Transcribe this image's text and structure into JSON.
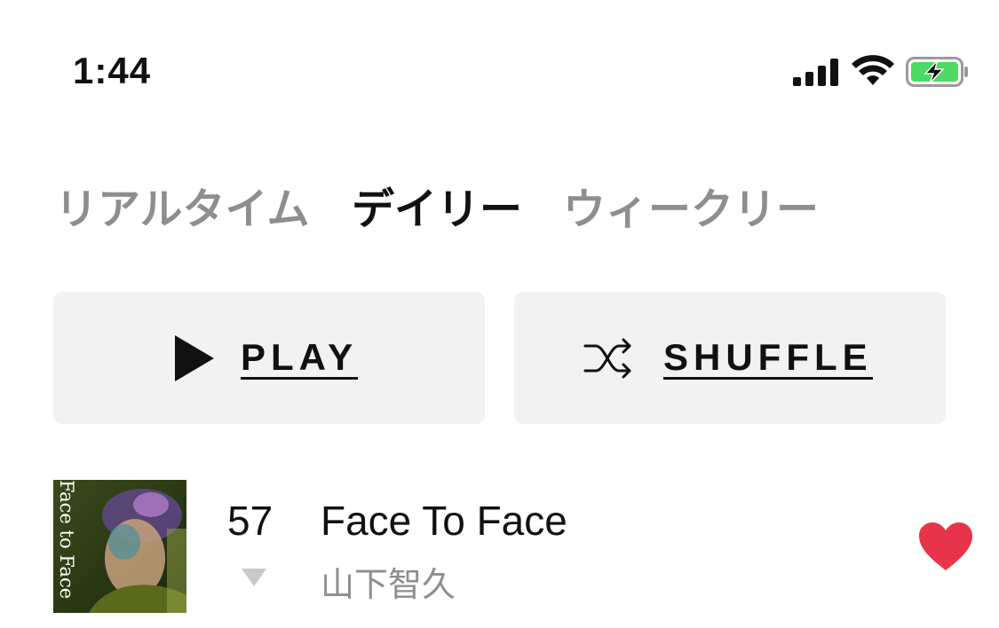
{
  "status_bar": {
    "time": "1:44",
    "signal_icon": "cellular-signal-icon",
    "wifi_icon": "wifi-icon",
    "battery_icon": "battery-charging-icon",
    "battery_color": "#4cd964"
  },
  "tabs": [
    {
      "label": "リアルタイム",
      "active": false
    },
    {
      "label": "デイリー",
      "active": true
    },
    {
      "label": "ウィークリー",
      "active": false
    }
  ],
  "actions": {
    "play_label": "PLAY",
    "play_icon": "play-icon",
    "shuffle_label": "SHUFFLE",
    "shuffle_icon": "shuffle-icon"
  },
  "track": {
    "rank": "57",
    "trend": "down",
    "title": "Face To Face",
    "artist": "山下智久",
    "artwork_text": "Face to Face",
    "liked": true,
    "heart_color": "#e8344a"
  }
}
